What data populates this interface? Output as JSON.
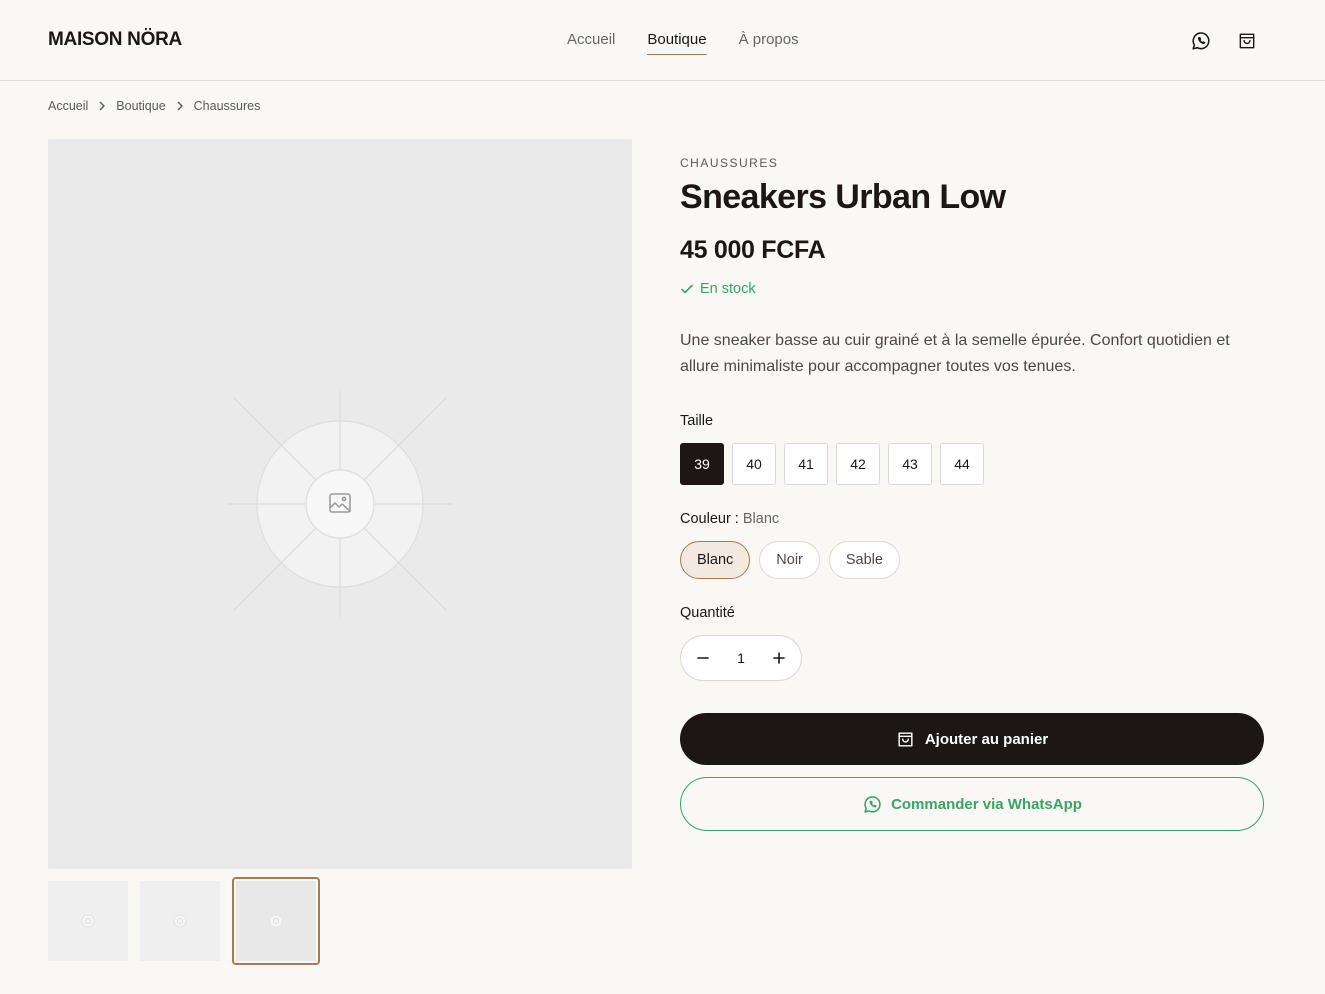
{
  "header": {
    "logo": "MAISON NÖRA",
    "nav": [
      {
        "label": "Accueil"
      },
      {
        "label": "Boutique"
      },
      {
        "label": "À propos"
      }
    ],
    "icons": [
      "whatsapp-icon",
      "shopping-bag-icon"
    ]
  },
  "breadcrumb": [
    "Accueil",
    "Boutique",
    "Chaussures"
  ],
  "gallery": {
    "icons": [
      "image-placeholder-icon"
    ],
    "thumbnail_count": 3,
    "selected_thumbnail": 3
  },
  "product": {
    "category": "CHAUSSURES",
    "title": "Sneakers Urban Low",
    "price": "45 000 FCFA",
    "stock": "En stock",
    "description": "Une sneaker basse au cuir grainé et à la semelle épurée. Confort quotidien et allure minimaliste pour accompagner toutes vos tenues.",
    "size_label": "Taille",
    "sizes": [
      "39",
      "40",
      "41",
      "42",
      "43",
      "44"
    ],
    "selected_size": "39",
    "color_label": "Couleur :",
    "selected_color": "Blanc",
    "colors": [
      "Blanc",
      "Noir",
      "Sable"
    ],
    "quantity_label": "Quantité",
    "quantity": "1",
    "add_to_cart": "Ajouter au panier",
    "whatsapp_order": "Commander via WhatsApp"
  },
  "colors": {
    "background": "#f9f8f5",
    "text": "#1c1714",
    "accent": "#a97a52",
    "success": "#3aa561",
    "placeholder": "#eaeaea"
  }
}
